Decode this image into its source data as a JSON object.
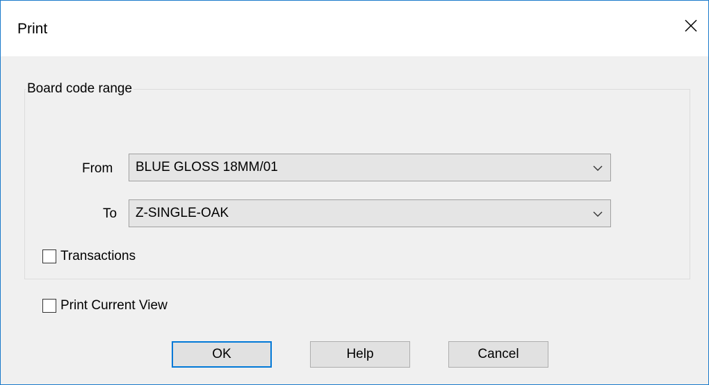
{
  "window": {
    "title": "Print",
    "close_icon": "close-icon"
  },
  "group": {
    "legend": "Board code range",
    "from_label": "From",
    "from_value": "BLUE GLOSS 18MM/01",
    "to_label": "To",
    "to_value": "Z-SINGLE-OAK",
    "transactions_label": "Transactions",
    "transactions_checked": false
  },
  "print_current_view": {
    "label": "Print Current View",
    "checked": false
  },
  "buttons": {
    "ok": "OK",
    "help": "Help",
    "cancel": "Cancel"
  },
  "colors": {
    "accent": "#0078d7",
    "window_border": "#1979ca",
    "background": "#f0f0f0",
    "titlebar": "#ffffff"
  }
}
